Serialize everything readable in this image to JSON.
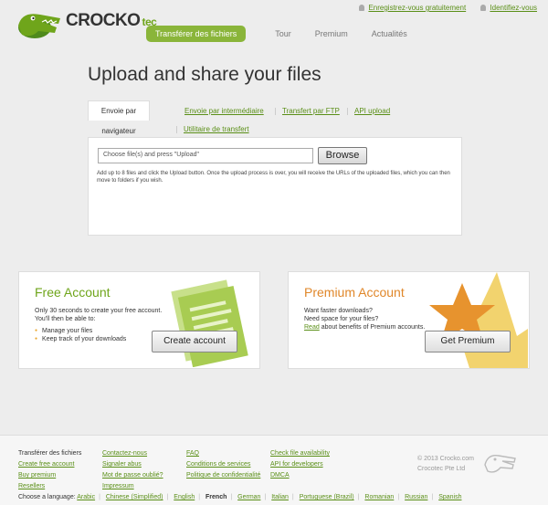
{
  "brand": {
    "name": "CROCKO",
    "suffix": "tec",
    "accent": "#6fa51b"
  },
  "top_links": {
    "register": "Enregistrez-vous gratuitement",
    "login": "Identifiez-vous"
  },
  "nav": [
    "Transférer des fichiers",
    "Tour",
    "Premium",
    "Actualités"
  ],
  "main": {
    "title": "Upload and share your files",
    "tabs": [
      "Envoie par navigateur",
      "Envoie par intermédiaire",
      "Transfert par FTP",
      "API upload",
      "Utilitaire de transfert"
    ],
    "file_placeholder": "Choose file(s) and press \"Upload\"",
    "browse": "Browse",
    "help": "Add up to 8 files and click the Upload button. Once the upload process is over, you will receive the URLs of the uploaded files, which you can then move to folders if you wish."
  },
  "free": {
    "title": "Free Account",
    "line1": "Only 30 seconds to create your free account.",
    "line2": "You'll then be able to:",
    "items": [
      "Manage your files",
      "Keep track of your downloads"
    ],
    "button": "Create account"
  },
  "premium": {
    "title": "Premium Account",
    "line1": "Want faster downloads?",
    "line2": "Need space for your files?",
    "read_link": "Read",
    "line3": "about benefits of Premium accounts.",
    "button": "Get Premium"
  },
  "footer": {
    "col1": [
      "Transférer des fichiers",
      "Create free account",
      "Buy premium",
      "Resellers"
    ],
    "col2": [
      "Contactez-nous",
      "Signaler abus",
      "Mot de passe oublié?",
      "Impressum"
    ],
    "col3": [
      "FAQ",
      "Conditions de services",
      "Politique de confidentialité"
    ],
    "col4": [
      "Check file availability",
      "API for developers",
      "DMCA"
    ],
    "copyright1": "© 2013 Crocko.com",
    "copyright2": "Crocotec Pte Ltd",
    "lang_label": "Choose a language:",
    "languages": [
      "Arabic",
      "Chinese (Simplified)",
      "English",
      "French",
      "German",
      "Italian",
      "Portuguese (Brazil)",
      "Romanian",
      "Russian",
      "Spanish"
    ],
    "current_language": "French"
  }
}
